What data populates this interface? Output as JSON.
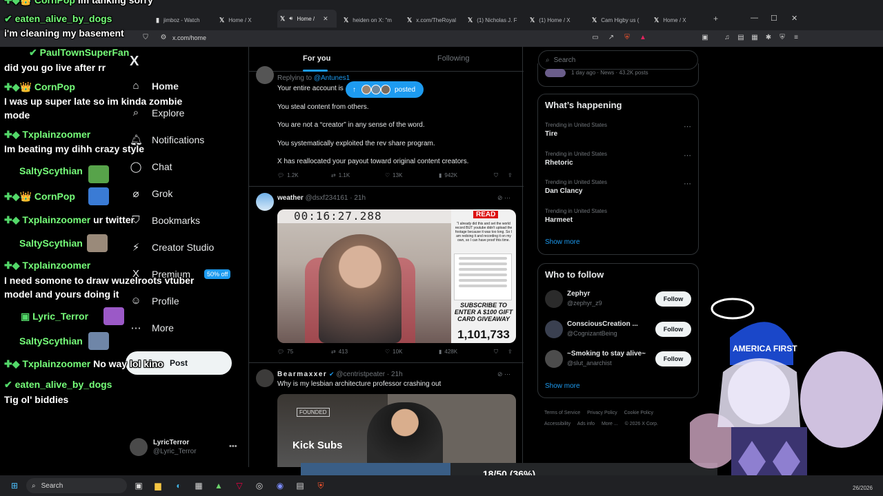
{
  "browser": {
    "tabs": [
      {
        "title": "jimboz - Watch",
        "active": false
      },
      {
        "title": "Home / X",
        "active": false
      },
      {
        "title": "Home /",
        "active": true
      },
      {
        "title": "heiden on X: \"m",
        "active": false
      },
      {
        "title": "x.com/TheRoyal",
        "active": false
      },
      {
        "title": "(1) Nicholas J. F",
        "active": false
      },
      {
        "title": "(1) Home / X",
        "active": false
      },
      {
        "title": "Cam Higby us (",
        "active": false
      },
      {
        "title": "Home / X",
        "active": false
      }
    ],
    "url": "x.com/home"
  },
  "nav": {
    "logo": "X",
    "items": [
      {
        "label": "Home",
        "icon": "home-icon",
        "glyph": "⌂",
        "active": true
      },
      {
        "label": "Explore",
        "icon": "search-icon",
        "glyph": "⌕",
        "active": false
      },
      {
        "label": "Notifications",
        "icon": "bell-icon",
        "glyph": "🔔︎",
        "active": false
      },
      {
        "label": "Chat",
        "icon": "chat-icon",
        "glyph": "◯",
        "active": false
      },
      {
        "label": "Grok",
        "icon": "grok-icon",
        "glyph": "⌀",
        "active": false
      },
      {
        "label": "Bookmarks",
        "icon": "bookmark-icon",
        "glyph": "⛉",
        "active": false
      },
      {
        "label": "Creator Studio",
        "icon": "creator-icon",
        "glyph": "⚡︎",
        "active": false
      },
      {
        "label": "Premium",
        "icon": "premium-icon",
        "glyph": "X",
        "active": false
      },
      {
        "label": "Profile",
        "icon": "profile-icon",
        "glyph": "☺",
        "active": false
      },
      {
        "label": "More",
        "icon": "more-icon",
        "glyph": "⋯",
        "active": false
      }
    ],
    "premium_badge": "50% off",
    "post_button": "Post",
    "account": {
      "name": "LyricTerror",
      "handle": "@Lyric_Terror"
    }
  },
  "feed": {
    "tabs": {
      "for_you": "For you",
      "following": "Following"
    },
    "posted_pill": "posted",
    "tweet1": {
      "replying_to_prefix": "Replying to ",
      "replying_to_handle": "@Antunes1",
      "lines": [
        "Your entire account is",
        "You steal content from others.",
        "You are not a “creator” in any sense of the word.",
        "You systematically exploited the rev share program.",
        "X has reallocated your payout toward original content creators."
      ],
      "replies": "1.2K",
      "reposts": "1.1K",
      "likes": "13K",
      "views": "942K"
    },
    "tweet2": {
      "name": "weather",
      "handle": "@dsxf234161 · 21h",
      "media_timer": "00:16:27.288",
      "media_read": "READ",
      "media_quote": "\"I already did this and set the world record BUT youtube didn't upload the footage because it was too long. So I am redoing it and recording it on my own, so I can have proof this time.",
      "media_sub": "SUBSCRIBE TO ENTER A $100 GIFT CARD GIVEAWAY",
      "media_count": "1,101,733",
      "replies": "75",
      "reposts": "413",
      "likes": "10K",
      "views": "428K"
    },
    "tweet3": {
      "name": "Bearmaxxer",
      "handle": "@centristpeater · 21h",
      "text": "Why is my lesbian architecture professor crashing out",
      "media_label": "Kick Subs",
      "media_badge": "FOUNDED"
    }
  },
  "right": {
    "search_placeholder": "Search",
    "top_card_meta": "1 day ago · News · 43.2K posts",
    "whats_happening": "What’s happening",
    "trends": [
      {
        "context": "Trending in United States",
        "name": "Tire"
      },
      {
        "context": "Trending in United States",
        "name": "Rhetoric"
      },
      {
        "context": "Trending in United States",
        "name": "Dan Clancy"
      },
      {
        "context": "Trending in United States",
        "name": "Harmeet"
      }
    ],
    "show_more": "Show more",
    "who_to_follow": "Who to follow",
    "follow": [
      {
        "name": "Zephyr",
        "handle": "@zephyr_z9",
        "button": "Follow"
      },
      {
        "name": "ConsciousCreation ...",
        "handle": "@CognizantBeing",
        "button": "Follow"
      },
      {
        "name": "~Smoking to stay alive~",
        "handle": "@slut_anarchist",
        "button": "Follow"
      }
    ],
    "follow_show_more": "Show more",
    "footer": [
      "Terms of Service",
      "Privacy Policy",
      "Cookie Policy",
      "Accessibility",
      "Ads info",
      "More ...",
      "© 2026 X Corp."
    ]
  },
  "stream": {
    "chat": [
      {
        "user": "CornPop",
        "msg": "im tanking sorry",
        "badges": "✚◆👑"
      },
      {
        "user": "eaten_alive_by_dogs",
        "msg": "",
        "badges": "✔"
      },
      {
        "user": "",
        "msg": "i'm cleaning my basement",
        "badges": ""
      },
      {
        "user": "PaulTownSuperFan",
        "msg": "",
        "badges": "✔"
      },
      {
        "user": "",
        "msg": "did you go live after rr",
        "badges": ""
      },
      {
        "user": "CornPop",
        "msg": "",
        "badges": "✚◆👑"
      },
      {
        "user": "",
        "msg": "I was up super late so im kinda zombie",
        "badges": ""
      },
      {
        "user": "",
        "msg": "mode",
        "badges": ""
      },
      {
        "user": "Txplainzoomer",
        "msg": "",
        "badges": "✚◆"
      },
      {
        "user": "",
        "msg": "Im beating my dihh crazy style",
        "badges": ""
      },
      {
        "user": "SaltyScythian",
        "msg": "",
        "badges": ""
      },
      {
        "user": "CornPop",
        "msg": "",
        "badges": "✚◆👑"
      },
      {
        "user": "Txplainzoomer",
        "msg": "ur twitter",
        "badges": "✚◆"
      },
      {
        "user": "SaltyScythian",
        "msg": "",
        "badges": ""
      },
      {
        "user": "Txplainzoomer",
        "msg": "",
        "badges": "✚◆"
      },
      {
        "user": "",
        "msg": "I need somone to draw wuzelroots vtuber",
        "badges": ""
      },
      {
        "user": "",
        "msg": "model and yours doing it",
        "badges": ""
      },
      {
        "user": "Lyric_Terror",
        "msg": "",
        "badges": "▣"
      },
      {
        "user": "SaltyScythian",
        "msg": "",
        "badges": ""
      },
      {
        "user": "Txplainzoomer",
        "msg": "No way lol kino",
        "badges": "✚◆"
      },
      {
        "user": "eaten_alive_by_dogs",
        "msg": "",
        "badges": "✔"
      },
      {
        "user": "",
        "msg": "Tig ol' biddies",
        "badges": ""
      }
    ],
    "progress": {
      "text": "18/50 (36%)",
      "fraction": 0.36,
      "color": "#3a5e86"
    },
    "vtuber_hat_text": "AMERICA FIRST"
  },
  "taskbar": {
    "search": "Search",
    "date": "26/2026"
  },
  "colors": {
    "accent": "#1d9bf0",
    "chat_user": "#76ff7a"
  }
}
